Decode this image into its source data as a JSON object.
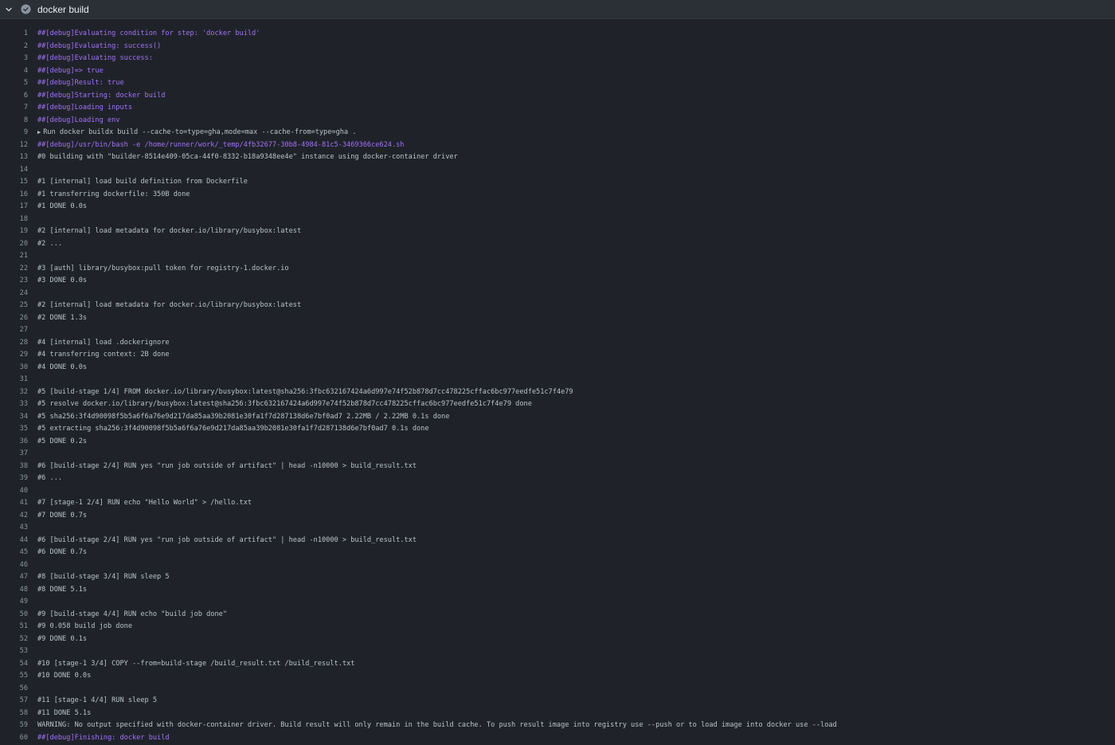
{
  "step": {
    "title": "docker build",
    "status": "success",
    "status_color": "#8b949e"
  },
  "log_lines": [
    {
      "n": "1",
      "t": "##[debug]Evaluating condition for step: 'docker build'",
      "type": "debug"
    },
    {
      "n": "2",
      "t": "##[debug]Evaluating: success()",
      "type": "debug"
    },
    {
      "n": "3",
      "t": "##[debug]Evaluating success:",
      "type": "debug"
    },
    {
      "n": "4",
      "t": "##[debug]=> true",
      "type": "debug"
    },
    {
      "n": "5",
      "t": "##[debug]Result: true",
      "type": "debug"
    },
    {
      "n": "6",
      "t": "##[debug]Starting: docker build",
      "type": "debug"
    },
    {
      "n": "7",
      "t": "##[debug]Loading inputs",
      "type": "debug"
    },
    {
      "n": "8",
      "t": "##[debug]Loading env",
      "type": "debug"
    },
    {
      "n": "9",
      "t": "Run docker buildx build --cache-to=type=gha,mode=max --cache-from=type=gha .",
      "type": "group"
    },
    {
      "n": "12",
      "t": "##[debug]/usr/bin/bash -e /home/runner/work/_temp/4fb32677-30b8-4984-81c5-3469366ce624.sh",
      "type": "debug"
    },
    {
      "n": "13",
      "t": "#0 building with \"builder-8514e409-05ca-44f0-8332-b18a9348ee4e\" instance using docker-container driver",
      "type": "normal"
    },
    {
      "n": "14",
      "t": "",
      "type": "normal"
    },
    {
      "n": "15",
      "t": "#1 [internal] load build definition from Dockerfile",
      "type": "normal"
    },
    {
      "n": "16",
      "t": "#1 transferring dockerfile: 350B done",
      "type": "normal"
    },
    {
      "n": "17",
      "t": "#1 DONE 0.0s",
      "type": "normal"
    },
    {
      "n": "18",
      "t": "",
      "type": "normal"
    },
    {
      "n": "19",
      "t": "#2 [internal] load metadata for docker.io/library/busybox:latest",
      "type": "normal"
    },
    {
      "n": "20",
      "t": "#2 ...",
      "type": "normal"
    },
    {
      "n": "21",
      "t": "",
      "type": "normal"
    },
    {
      "n": "22",
      "t": "#3 [auth] library/busybox:pull token for registry-1.docker.io",
      "type": "normal"
    },
    {
      "n": "23",
      "t": "#3 DONE 0.0s",
      "type": "normal"
    },
    {
      "n": "24",
      "t": "",
      "type": "normal"
    },
    {
      "n": "25",
      "t": "#2 [internal] load metadata for docker.io/library/busybox:latest",
      "type": "normal"
    },
    {
      "n": "26",
      "t": "#2 DONE 1.3s",
      "type": "normal"
    },
    {
      "n": "27",
      "t": "",
      "type": "normal"
    },
    {
      "n": "28",
      "t": "#4 [internal] load .dockerignore",
      "type": "normal"
    },
    {
      "n": "29",
      "t": "#4 transferring context: 2B done",
      "type": "normal"
    },
    {
      "n": "30",
      "t": "#4 DONE 0.0s",
      "type": "normal"
    },
    {
      "n": "31",
      "t": "",
      "type": "normal"
    },
    {
      "n": "32",
      "t": "#5 [build-stage 1/4] FROM docker.io/library/busybox:latest@sha256:3fbc632167424a6d997e74f52b878d7cc478225cffac6bc977eedfe51c7f4e79",
      "type": "normal"
    },
    {
      "n": "33",
      "t": "#5 resolve docker.io/library/busybox:latest@sha256:3fbc632167424a6d997e74f52b878d7cc478225cffac6bc977eedfe51c7f4e79 done",
      "type": "normal"
    },
    {
      "n": "34",
      "t": "#5 sha256:3f4d90098f5b5a6f6a76e9d217da85aa39b2081e30fa1f7d287138d6e7bf0ad7 2.22MB / 2.22MB 0.1s done",
      "type": "normal"
    },
    {
      "n": "35",
      "t": "#5 extracting sha256:3f4d90098f5b5a6f6a76e9d217da85aa39b2081e30fa1f7d287138d6e7bf0ad7 0.1s done",
      "type": "normal"
    },
    {
      "n": "36",
      "t": "#5 DONE 0.2s",
      "type": "normal"
    },
    {
      "n": "37",
      "t": "",
      "type": "normal"
    },
    {
      "n": "38",
      "t": "#6 [build-stage 2/4] RUN yes \"run job outside of artifact\" | head -n10000 > build_result.txt",
      "type": "normal"
    },
    {
      "n": "39",
      "t": "#6 ...",
      "type": "normal"
    },
    {
      "n": "40",
      "t": "",
      "type": "normal"
    },
    {
      "n": "41",
      "t": "#7 [stage-1 2/4] RUN echo \"Hello World\" > /hello.txt",
      "type": "normal"
    },
    {
      "n": "42",
      "t": "#7 DONE 0.7s",
      "type": "normal"
    },
    {
      "n": "43",
      "t": "",
      "type": "normal"
    },
    {
      "n": "44",
      "t": "#6 [build-stage 2/4] RUN yes \"run job outside of artifact\" | head -n10000 > build_result.txt",
      "type": "normal"
    },
    {
      "n": "45",
      "t": "#6 DONE 0.7s",
      "type": "normal"
    },
    {
      "n": "46",
      "t": "",
      "type": "normal"
    },
    {
      "n": "47",
      "t": "#8 [build-stage 3/4] RUN sleep 5",
      "type": "normal"
    },
    {
      "n": "48",
      "t": "#8 DONE 5.1s",
      "type": "normal"
    },
    {
      "n": "49",
      "t": "",
      "type": "normal"
    },
    {
      "n": "50",
      "t": "#9 [build-stage 4/4] RUN echo \"build job done\"",
      "type": "normal"
    },
    {
      "n": "51",
      "t": "#9 0.058 build job done",
      "type": "normal"
    },
    {
      "n": "52",
      "t": "#9 DONE 0.1s",
      "type": "normal"
    },
    {
      "n": "53",
      "t": "",
      "type": "normal"
    },
    {
      "n": "54",
      "t": "#10 [stage-1 3/4] COPY --from=build-stage /build_result.txt /build_result.txt",
      "type": "normal"
    },
    {
      "n": "55",
      "t": "#10 DONE 0.0s",
      "type": "normal"
    },
    {
      "n": "56",
      "t": "",
      "type": "normal"
    },
    {
      "n": "57",
      "t": "#11 [stage-1 4/4] RUN sleep 5",
      "type": "normal"
    },
    {
      "n": "58",
      "t": "#11 DONE 5.1s",
      "type": "normal"
    },
    {
      "n": "59",
      "t": "WARNING: No output specified with docker-container driver. Build result will only remain in the build cache. To push result image into registry use --push or to load image into docker use --load",
      "type": "normal"
    },
    {
      "n": "60",
      "t": "##[debug]Finishing: docker build",
      "type": "debug"
    }
  ]
}
